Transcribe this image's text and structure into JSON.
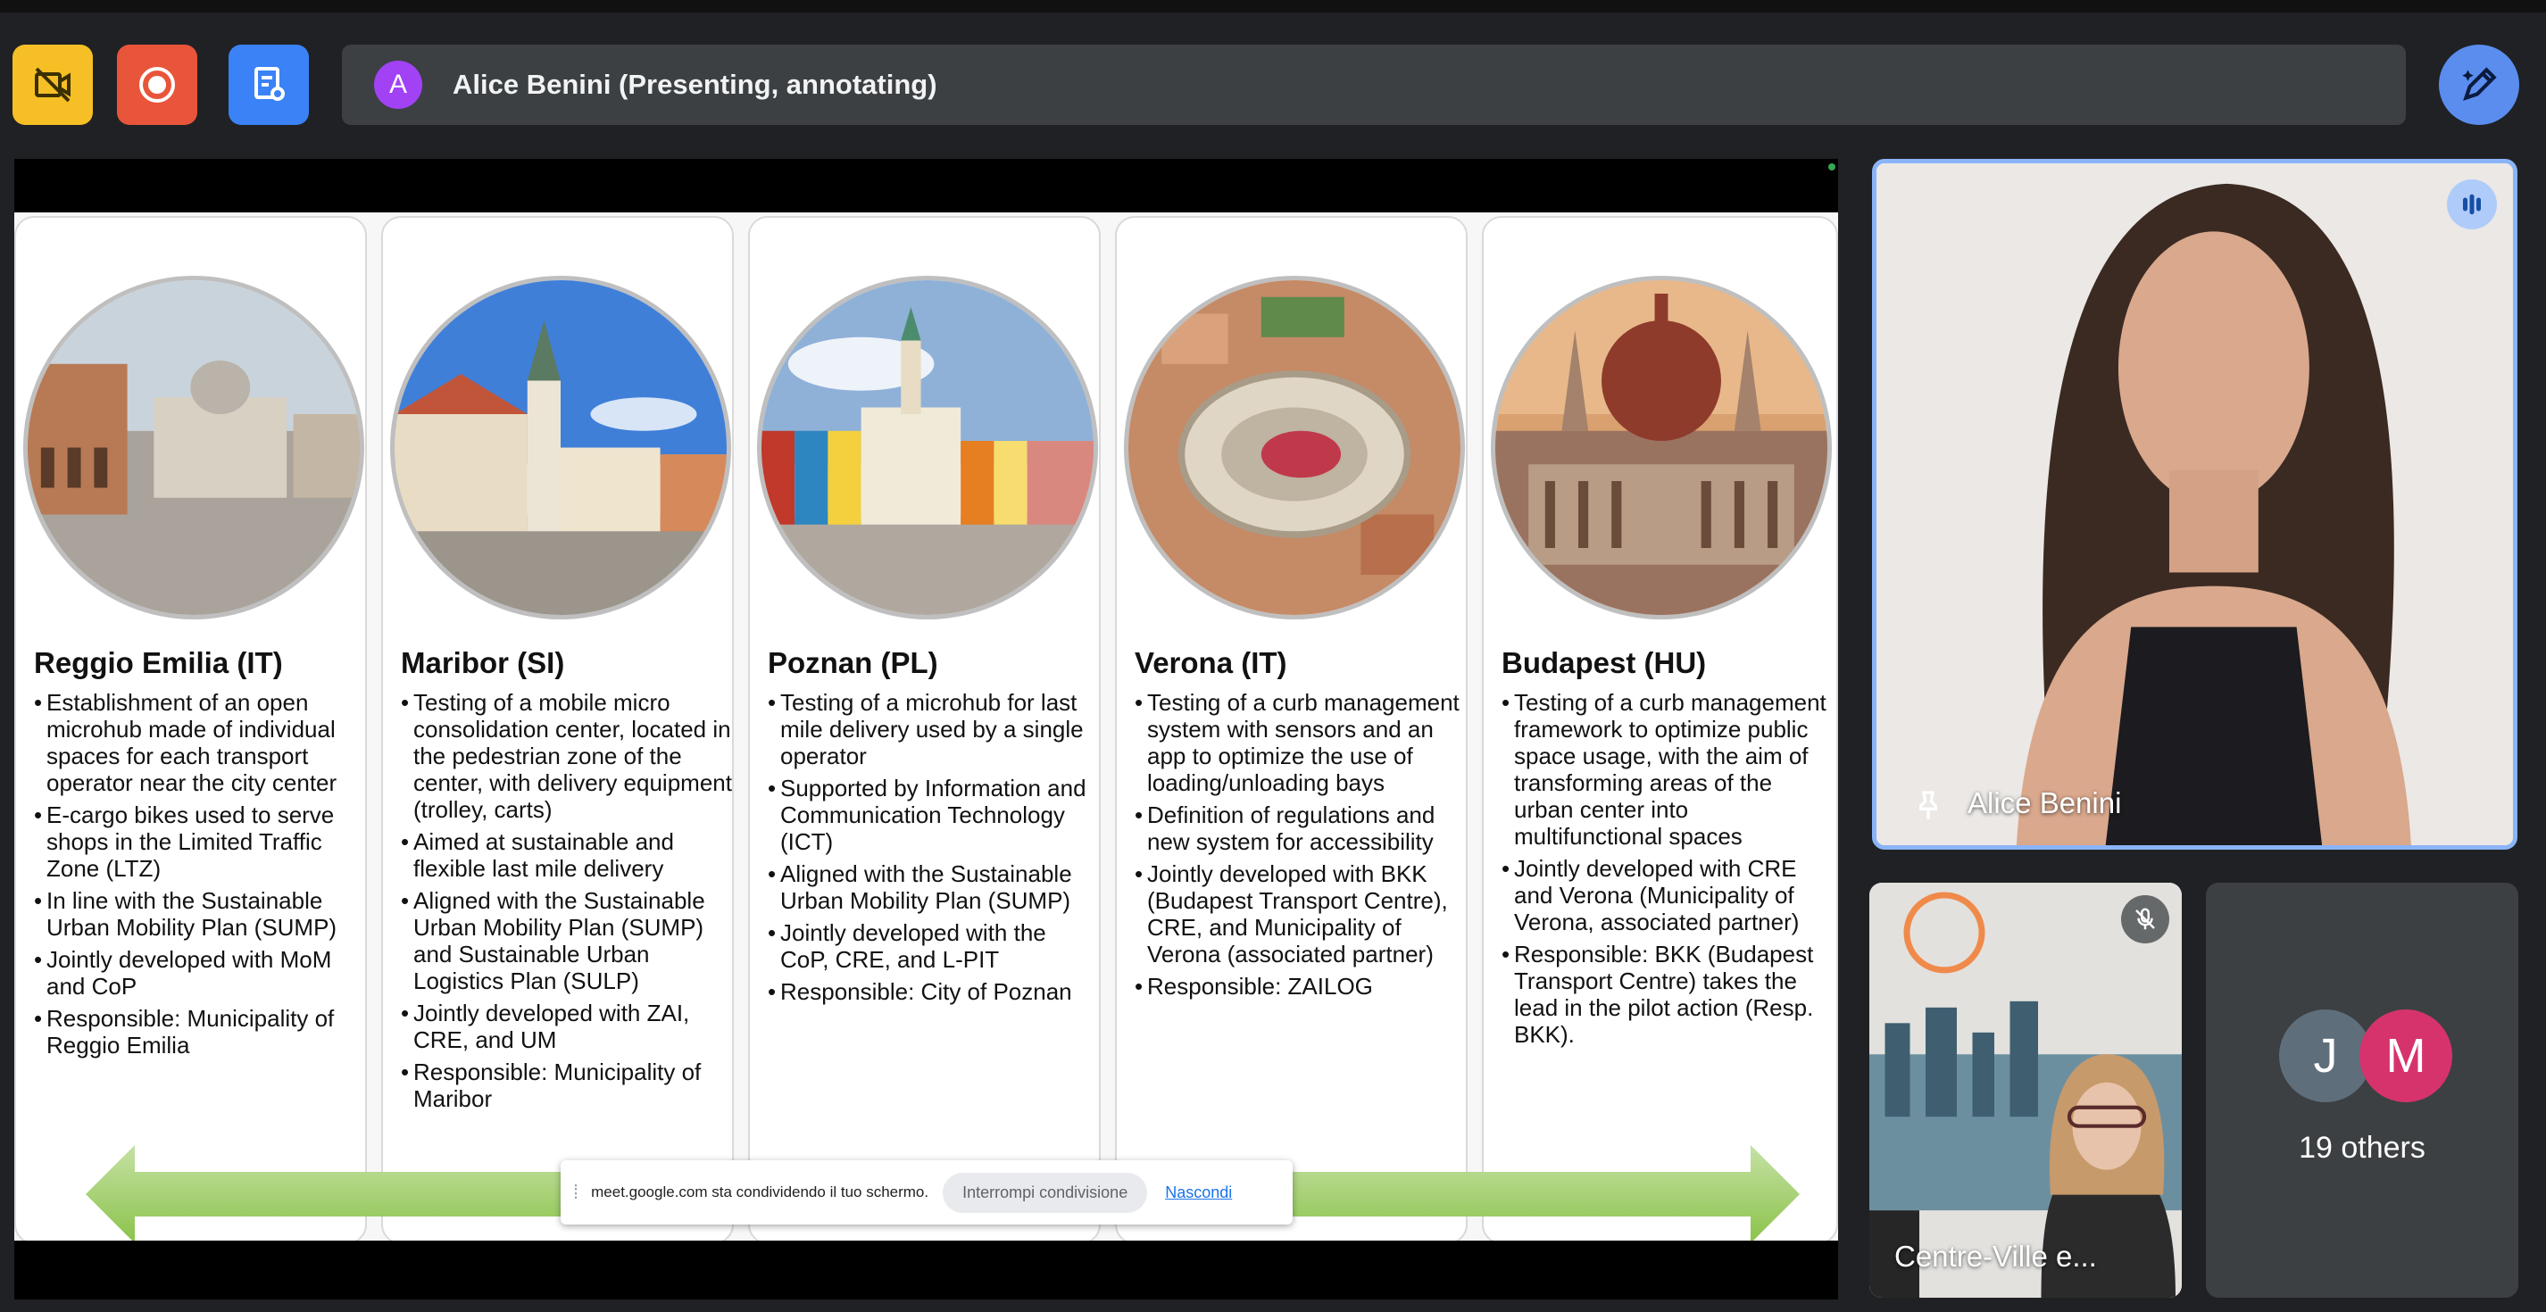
{
  "toolbar": {
    "hide_self_icon": "video-off-icon",
    "record_icon": "record-icon",
    "present_icon": "present-icon"
  },
  "presenter": {
    "avatar_letter": "A",
    "status_text": "Alice Benini (Presenting, annotating)"
  },
  "annotate_icon": "pen-sparkle-icon",
  "slide": {
    "cards": [
      {
        "title": "Reggio Emilia (IT)",
        "bullets": [
          "Establishment of an open microhub made of individual spaces for each transport operator near the city center",
          "E-cargo bikes used to serve shops in the Limited Traffic Zone (LTZ)",
          "In line with the Sustainable Urban Mobility Plan (SUMP)",
          "Jointly developed with MoM and CoP",
          "Responsible: Municipality of Reggio Emilia"
        ]
      },
      {
        "title": "Maribor (SI)",
        "bullets": [
          "Testing of a mobile micro consolidation center, located in the pedestrian zone of the center, with delivery equipment (trolley, carts)",
          "Aimed at sustainable and flexible last mile delivery",
          "Aligned with the Sustainable Urban Mobility Plan (SUMP) and Sustainable Urban Logistics Plan (SULP)",
          "Jointly developed with ZAI, CRE, and UM",
          "Responsible: Municipality of Maribor"
        ]
      },
      {
        "title": "Poznan (PL)",
        "bullets": [
          "Testing of a microhub for last mile delivery used by a single operator",
          "Supported by Information and Communication Technology (ICT)",
          "Aligned with the Sustainable Urban Mobility Plan (SUMP)",
          "Jointly developed with the CoP, CRE, and L-PIT",
          "Responsible: City of Poznan"
        ]
      },
      {
        "title": "Verona (IT)",
        "bullets": [
          "Testing of a curb management system with sensors and an app to optimize the use of loading/unloading bays",
          "Definition of regulations and new system for accessibility",
          "Jointly developed with BKK (Budapest Transport Centre), CRE, and Municipality of Verona (associated partner)",
          "Responsible: ZAILOG"
        ]
      },
      {
        "title": "Budapest (HU)",
        "bullets": [
          "Testing of a curb management framework to optimize public space usage, with the aim of transforming areas of the urban center into multifunctional spaces",
          "Jointly developed with CRE and Verona (Municipality of Verona, associated partner)",
          "Responsible: BKK (Budapest Transport Centre) takes the lead in the pilot action (Resp. BKK)."
        ]
      }
    ]
  },
  "share_bar": {
    "grip": "⁞",
    "message": "meet.google.com sta condividendo il tuo schermo.",
    "stop_label": "Interrompi condivisione",
    "hide_label": "Nascondi"
  },
  "participants": {
    "main_name": "Alice Benini",
    "second_name": "Centre-Ville e...",
    "second_logo": "centre-ville-logo",
    "avatar_j": "J",
    "avatar_m": "M",
    "others_label": "19 others"
  },
  "colors": {
    "bar_bg": "#3c4043",
    "accent_blue": "#8ab4f8",
    "arrow_green": "#9ccc65"
  }
}
